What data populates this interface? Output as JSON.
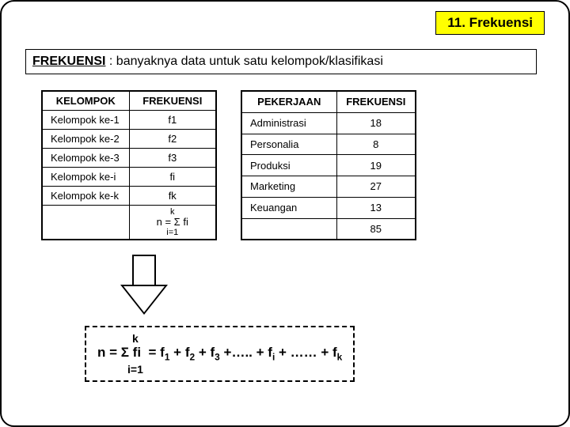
{
  "header": {
    "title": "11. Frekuensi"
  },
  "definition": {
    "term": "FREKUENSI",
    "text": " : banyaknya data untuk satu kelompok/klasifikasi"
  },
  "table1": {
    "headers": [
      "KELOMPOK",
      "FREKUENSI"
    ],
    "rows": [
      [
        "Kelompok ke-1",
        "f1"
      ],
      [
        "Kelompok ke-2",
        "f2"
      ],
      [
        "Kelompok ke-3",
        "f3"
      ],
      [
        "Kelompok ke-i",
        "fi"
      ],
      [
        "Kelompok ke-k",
        "fk"
      ]
    ],
    "formula": {
      "top": "k",
      "mid": "n = Σ fi",
      "bot": "i=1"
    }
  },
  "table2": {
    "headers": [
      "PEKERJAAN",
      "FREKUENSI"
    ],
    "rows": [
      [
        "Administrasi",
        "18"
      ],
      [
        "Personalia",
        "8"
      ],
      [
        "Produksi",
        "19"
      ],
      [
        "Marketing",
        "27"
      ],
      [
        "Keuangan",
        "13"
      ]
    ],
    "total": "85"
  },
  "equation": {
    "top": "k",
    "mid_prefix": "n = Σ fi  = f",
    "mid": "n = Σ fi  = f1 + f2 + f3 +….. + fi + …… + fk",
    "bot": "i=1"
  },
  "chart_data": {
    "type": "table",
    "title": "Frekuensi per Pekerjaan",
    "categories": [
      "Administrasi",
      "Personalia",
      "Produksi",
      "Marketing",
      "Keuangan"
    ],
    "values": [
      18,
      8,
      19,
      27,
      13
    ],
    "total": 85
  }
}
